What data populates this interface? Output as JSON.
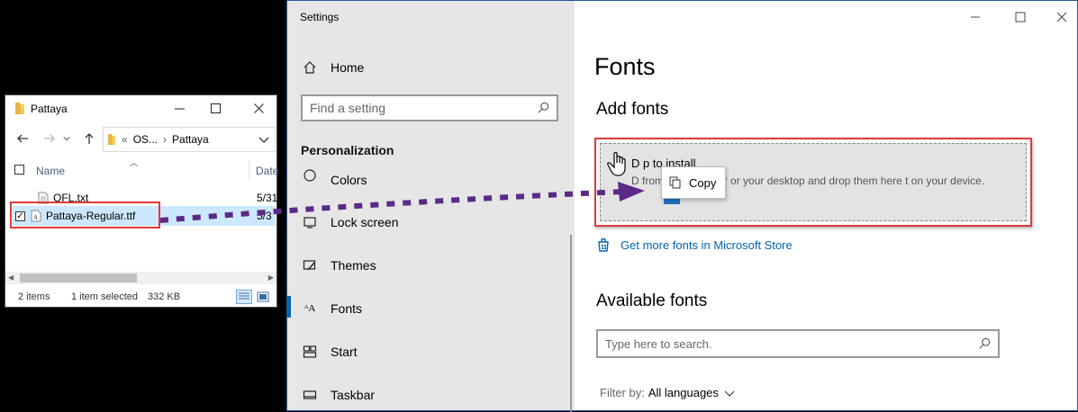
{
  "settings": {
    "title": "Settings",
    "nav": {
      "home": "Home",
      "search_placeholder": "Find a setting",
      "section": "Personalization",
      "items": [
        {
          "label": "Colors",
          "icon": "colors-icon"
        },
        {
          "label": "Lock screen",
          "icon": "lock-screen-icon"
        },
        {
          "label": "Themes",
          "icon": "themes-icon"
        },
        {
          "label": "Fonts",
          "icon": "fonts-icon"
        },
        {
          "label": "Start",
          "icon": "start-icon"
        },
        {
          "label": "Taskbar",
          "icon": "taskbar-icon"
        }
      ]
    },
    "content": {
      "page_title": "Fonts",
      "add_fonts": "Add fonts",
      "drop_title": "D           p to install",
      "drop_desc": "D           from File Explorer or your desktop and drop them here t            on your device.",
      "copy_tooltip": "Copy",
      "store_link": "Get more fonts in Microsoft Store",
      "available_fonts": "Available fonts",
      "fonts_search_placeholder": "Type here to search.",
      "filter_label": "Filter by:",
      "filter_value": "All languages"
    }
  },
  "explorer": {
    "title": "Pattaya",
    "address": {
      "part1": "«",
      "part2": "OS...",
      "part3": "Pattaya"
    },
    "columns": {
      "name": "Name",
      "date": "Date"
    },
    "files": [
      {
        "name": "OFL.txt",
        "date": "5/31"
      },
      {
        "name": "Pattaya-Regular.ttf",
        "date": "5/3"
      }
    ],
    "status": {
      "count": "2 items",
      "selection": "1 item selected",
      "size": "332 KB"
    }
  },
  "colors": {
    "accent": "#0063b1",
    "highlight": "#e03a3a",
    "arrow": "#5b2a86"
  }
}
